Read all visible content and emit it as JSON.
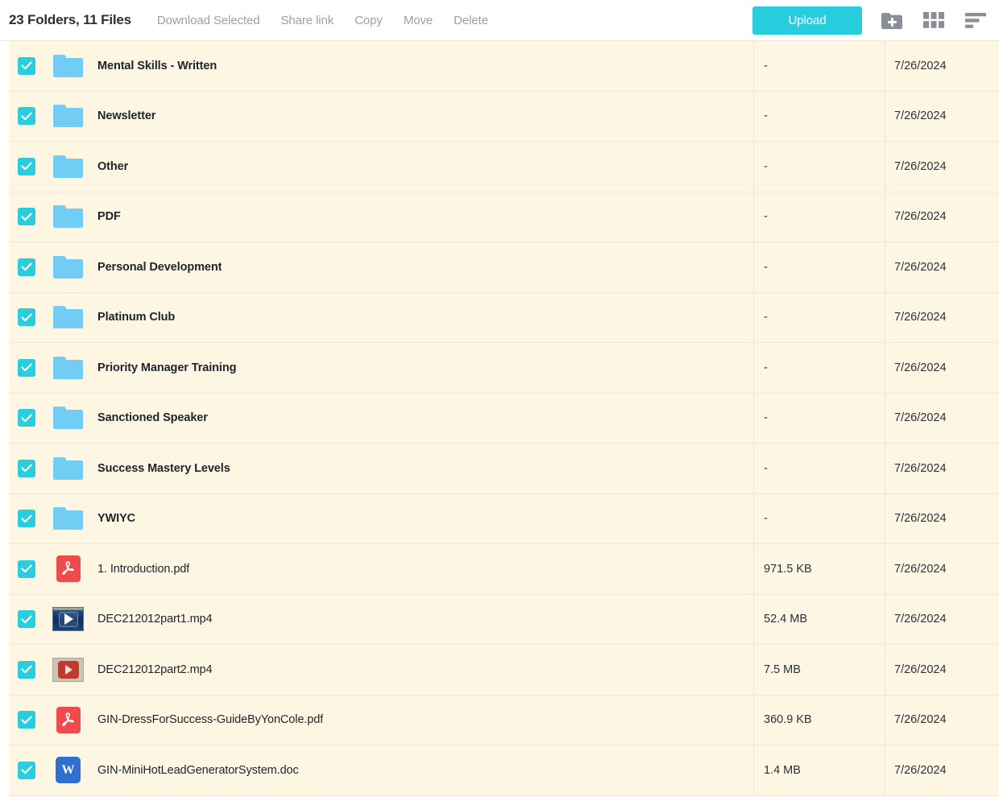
{
  "toolbar": {
    "summary": "23 Folders, 11 Files",
    "download_selected": "Download Selected",
    "share_link": "Share link",
    "copy": "Copy",
    "move": "Move",
    "delete": "Delete",
    "upload": "Upload",
    "new_folder_icon": "new-folder-icon",
    "grid_view_icon": "grid-view-icon",
    "sort_icon": "sort-icon",
    "accent_color": "#28cdde",
    "icon_color": "#8a8e96"
  },
  "table": {
    "row_background": "#fdf6e3",
    "checkbox_color": "#28cdde",
    "folder_color": "#72cdf4",
    "rows": [
      {
        "name": "Mental Skills - Written",
        "type": "folder",
        "icon": "folder-icon",
        "size": "-",
        "date": "7/26/2024",
        "checked": true
      },
      {
        "name": "Newsletter",
        "type": "folder",
        "icon": "folder-icon",
        "size": "-",
        "date": "7/26/2024",
        "checked": true
      },
      {
        "name": "Other",
        "type": "folder",
        "icon": "folder-icon",
        "size": "-",
        "date": "7/26/2024",
        "checked": true
      },
      {
        "name": "PDF",
        "type": "folder",
        "icon": "folder-icon",
        "size": "-",
        "date": "7/26/2024",
        "checked": true
      },
      {
        "name": "Personal Development",
        "type": "folder",
        "icon": "folder-icon",
        "size": "-",
        "date": "7/26/2024",
        "checked": true
      },
      {
        "name": "Platinum Club",
        "type": "folder",
        "icon": "folder-icon",
        "size": "-",
        "date": "7/26/2024",
        "checked": true
      },
      {
        "name": "Priority Manager Training",
        "type": "folder",
        "icon": "folder-icon",
        "size": "-",
        "date": "7/26/2024",
        "checked": true
      },
      {
        "name": "Sanctioned Speaker",
        "type": "folder",
        "icon": "folder-icon",
        "size": "-",
        "date": "7/26/2024",
        "checked": true
      },
      {
        "name": "Success Mastery Levels",
        "type": "folder",
        "icon": "folder-icon",
        "size": "-",
        "date": "7/26/2024",
        "checked": true
      },
      {
        "name": "YWIYC",
        "type": "folder",
        "icon": "folder-icon",
        "size": "-",
        "date": "7/26/2024",
        "checked": true
      },
      {
        "name": "1. Introduction.pdf",
        "type": "pdf",
        "icon": "pdf-file-icon",
        "size": "971.5 KB",
        "date": "7/26/2024",
        "checked": true
      },
      {
        "name": "DEC212012part1.mp4",
        "type": "video-dark",
        "icon": "video-thumbnail-icon",
        "size": "52.4 MB",
        "date": "7/26/2024",
        "checked": true
      },
      {
        "name": "DEC212012part2.mp4",
        "type": "video-red",
        "icon": "video-thumbnail-icon",
        "size": "7.5 MB",
        "date": "7/26/2024",
        "checked": true
      },
      {
        "name": "GIN-DressForSuccess-GuideByYonCole.pdf",
        "type": "pdf",
        "icon": "pdf-file-icon",
        "size": "360.9 KB",
        "date": "7/26/2024",
        "checked": true
      },
      {
        "name": "GIN-MiniHotLeadGeneratorSystem.doc",
        "type": "word",
        "icon": "word-file-icon",
        "size": "1.4 MB",
        "date": "7/26/2024",
        "checked": true
      }
    ]
  }
}
